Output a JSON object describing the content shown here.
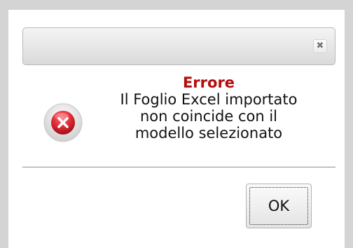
{
  "dialog": {
    "close_glyph": "✖",
    "icon": "error-x-icon",
    "title": "Errore",
    "message_lines": [
      "Il Foglio Excel importato",
      "non coincide con il",
      "modello selezionato"
    ],
    "ok_label": "OK"
  },
  "colors": {
    "title_red": "#b30d0d",
    "icon_red": "#e02b35",
    "page_gray": "#d4d4d4"
  }
}
